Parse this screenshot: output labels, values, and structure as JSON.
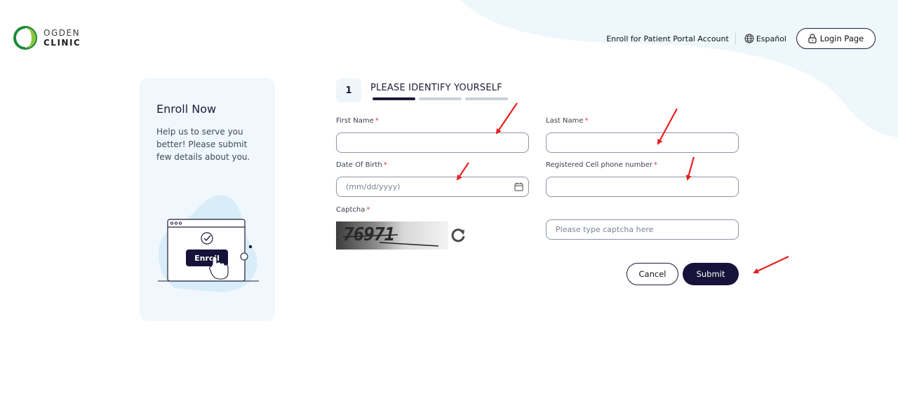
{
  "brand": {
    "line1": "OGDEN",
    "line2": "CLINIC",
    "accent": "#8cc63f",
    "dark": "#1d8a3c"
  },
  "nav": {
    "enroll_link": "Enroll for Patient Portal Account",
    "language": "Español",
    "login": "Login Page"
  },
  "side": {
    "title": "Enroll Now",
    "text": "Help us to serve you better! Please submit few details about you.",
    "illustration_button": "Enroll"
  },
  "step": {
    "number": "1",
    "title": "PLEASE IDENTIFY YOURSELF"
  },
  "form": {
    "first_name_label": "First Name",
    "last_name_label": "Last Name",
    "dob_label": "Date Of Birth",
    "dob_placeholder": "(mm/dd/yyyy)",
    "phone_label": "Registered Cell phone number",
    "captcha_label": "Captcha",
    "captcha_value": "76971",
    "captcha_placeholder": "Please type captcha here",
    "required_mark": "*",
    "cancel": "Cancel",
    "submit": "Submit"
  },
  "colors": {
    "primary": "#16123a",
    "required": "#e0303b",
    "annotation_arrow": "#e8201f",
    "card_bg": "#f1f8fd"
  }
}
